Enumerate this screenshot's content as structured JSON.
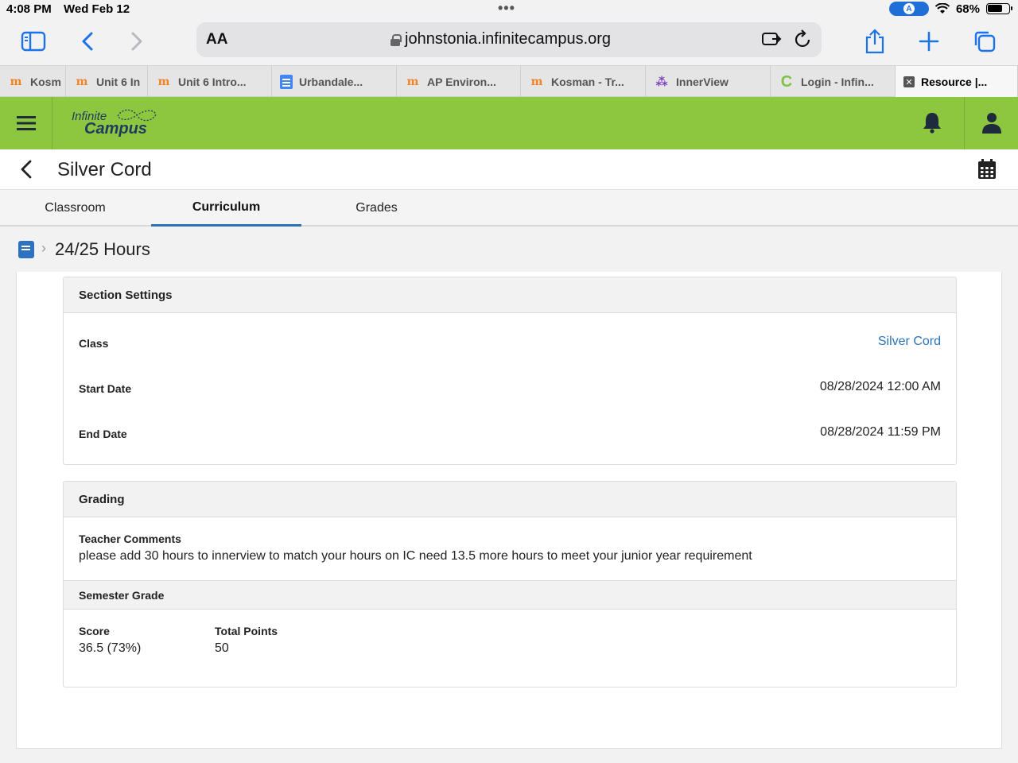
{
  "status": {
    "time": "4:08 PM",
    "date": "Wed Feb 12",
    "battery": "68%"
  },
  "browser": {
    "aa_label": "AA",
    "url": "johnstonia.infinitecampus.org",
    "tabs": [
      {
        "label": "Kosm",
        "favicon": "m"
      },
      {
        "label": "Unit 6 In",
        "favicon": "m"
      },
      {
        "label": "Unit 6 Intro...",
        "favicon": "m"
      },
      {
        "label": "Urbandale...",
        "favicon": "doc"
      },
      {
        "label": "AP Environ...",
        "favicon": "m"
      },
      {
        "label": "Kosman - Tr...",
        "favicon": "m"
      },
      {
        "label": "InnerView",
        "favicon": "iv"
      },
      {
        "label": "Login - Infin...",
        "favicon": "c"
      },
      {
        "label": "Resource |...",
        "favicon": "x"
      }
    ]
  },
  "app": {
    "logo_line1": "Infinite",
    "logo_line2": "Campus",
    "page_title": "Silver Cord"
  },
  "section_tabs": [
    "Classroom",
    "Curriculum",
    "Grades"
  ],
  "breadcrumb": "24/25 Hours",
  "section_settings": {
    "heading": "Section Settings",
    "rows": [
      {
        "label": "Class",
        "value": "Silver Cord"
      },
      {
        "label": "Start Date",
        "value": "08/28/2024 12:00 AM"
      },
      {
        "label": "End Date",
        "value": "08/28/2024 11:59 PM"
      }
    ]
  },
  "grading": {
    "heading": "Grading",
    "comments_label": "Teacher Comments",
    "comments": "please add 30 hours to innerview to match your hours on IC need 13.5 more hours to meet your junior year requirement",
    "semester_heading": "Semester Grade",
    "score_label": "Score",
    "score": "36.5 (73%)",
    "total_label": "Total Points",
    "total": "50"
  },
  "colors": {
    "header_green": "#8dc63f",
    "link_blue": "#2a74b8",
    "safari_blue": "#1a73e8"
  }
}
